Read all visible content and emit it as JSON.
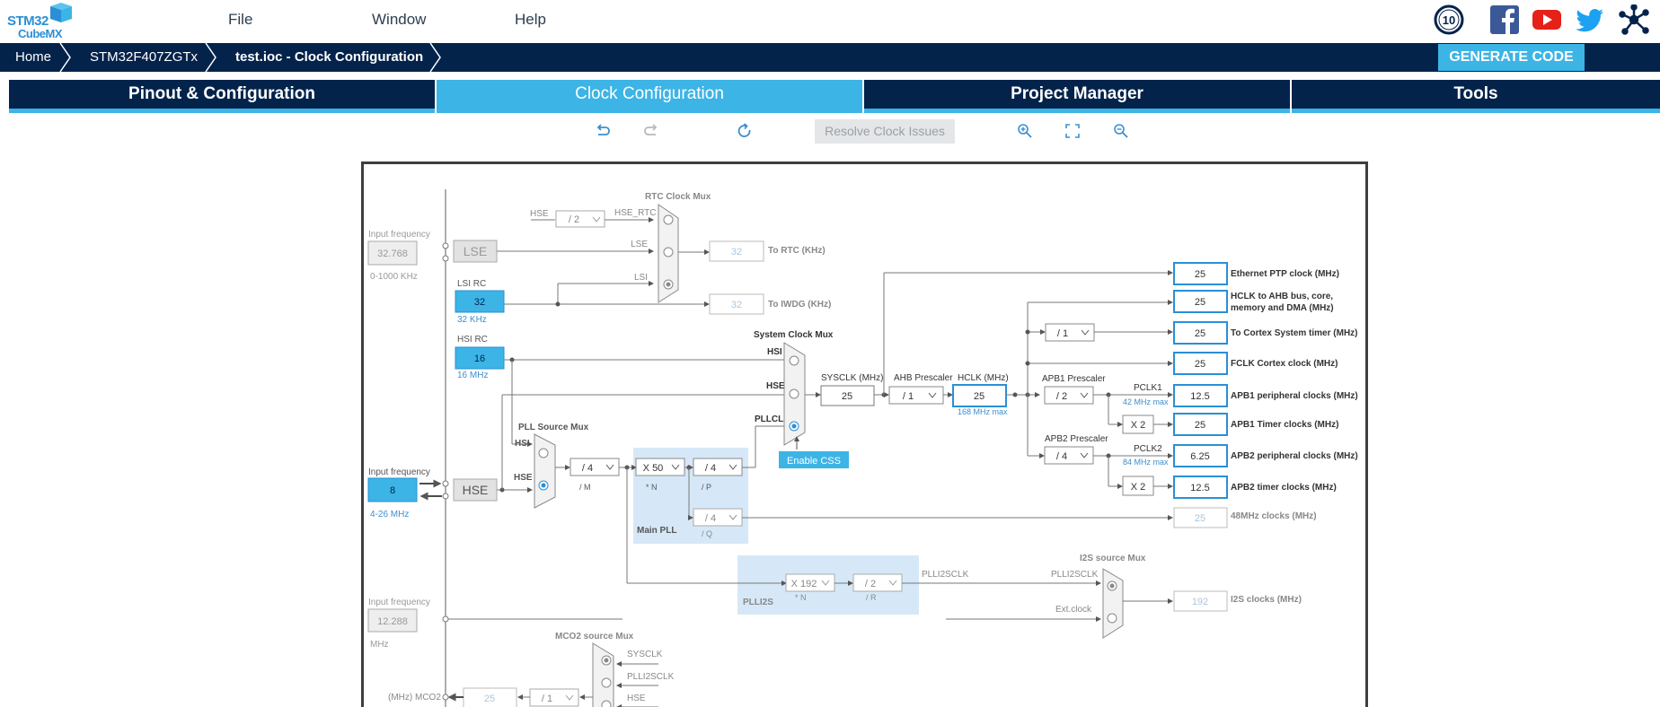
{
  "app": {
    "logo_line1": "STM32",
    "logo_line2": "CubeMX",
    "badge": "10"
  },
  "menu": {
    "file": "File",
    "window": "Window",
    "help": "Help"
  },
  "breadcrumb": {
    "home": "Home",
    "device": "STM32F407ZGTx",
    "file": "test.ioc - Clock Configuration"
  },
  "generate_label": "GENERATE CODE",
  "tabs": {
    "pinout": "Pinout & Configuration",
    "clock": "Clock Configuration",
    "project": "Project Manager",
    "tools": "Tools"
  },
  "toolbar": {
    "resolve": "Resolve Clock Issues"
  },
  "colors": {
    "navy": "#03234b",
    "accent": "#3cb4e6"
  },
  "clock": {
    "rtc_mux_title": "RTC Clock Mux",
    "hse_label": "HSE",
    "rtc_div": "/ 2",
    "hse_rtc": "HSE_RTC",
    "lse_in": "LSE",
    "lsi_in": "LSI",
    "input_freq": "Input frequency",
    "lse_freq": "32.768",
    "lse_range": "0-1000 KHz",
    "lse_block": "LSE",
    "rtc_val": "32",
    "rtc_label": "To RTC (KHz)",
    "lsi_title": "LSI RC",
    "lsi_val": "32",
    "lsi_unit": "32 KHz",
    "iwdg_val": "32",
    "iwdg_label": "To IWDG (KHz)",
    "hsi_title": "HSI RC",
    "hsi_val": "16",
    "hsi_unit": "16 MHz",
    "sysmux_title": "System Clock Mux",
    "hsi_in": "HSI",
    "hse_in": "HSE",
    "pllclk_in": "PLLCLK",
    "pll_src_title": "PLL Source Mux",
    "hse_freq": "8",
    "hse_range": "4-26 MHz",
    "hse_block": "HSE",
    "pllm": "/ 4",
    "pllm_lbl": "/ M",
    "plln": "X 50",
    "plln_lbl": "* N",
    "pllp": "/ 4",
    "pllp_lbl": "/ P",
    "pllq": "/ 4",
    "pllq_lbl": "/ Q",
    "main_pll": "Main PLL",
    "enable_css": "Enable CSS",
    "sysclk_lbl": "SYSCLK (MHz)",
    "sysclk_val": "25",
    "ahb_lbl": "AHB Prescaler",
    "ahb_val": "/ 1",
    "hclk_lbl": "HCLK (MHz)",
    "hclk_val": "25",
    "hclk_max": "168 MHz max",
    "apb1_lbl": "APB1 Prescaler",
    "apb1_val": "/ 2",
    "pclk1": "PCLK1",
    "pclk1_max": "42 MHz max",
    "apb2_lbl": "APB2 Prescaler",
    "apb2_val": "/ 4",
    "pclk2": "PCLK2",
    "pclk2_max": "84 MHz max",
    "cortex_div": "/ 1",
    "x2": "X 2",
    "outputs": [
      {
        "value": "25",
        "label": "Ethernet PTP clock (MHz)"
      },
      {
        "value": "25",
        "label": "HCLK to AHB bus, core,",
        "label2": "memory and DMA (MHz)"
      },
      {
        "value": "25",
        "label": "To Cortex System timer (MHz)"
      },
      {
        "value": "25",
        "label": "FCLK Cortex clock (MHz)"
      },
      {
        "value": "12.5",
        "label": "APB1 peripheral clocks (MHz)"
      },
      {
        "value": "25",
        "label": "APB1 Timer clocks (MHz)"
      },
      {
        "value": "6.25",
        "label": "APB2 peripheral clocks (MHz)"
      },
      {
        "value": "12.5",
        "label": "APB2 timer clocks (MHz)"
      },
      {
        "value": "25",
        "label": "48MHz clocks (MHz)"
      }
    ],
    "i2s_mux_title": "I2S source Mux",
    "plli2s_n": "X 192",
    "plli2s_n_lbl": "* N",
    "plli2s_r": "/ 2",
    "plli2s_r_lbl": "/ R",
    "plli2s": "PLLI2S",
    "plli2sclk": "PLLI2SCLK",
    "ext_clock": "Ext.clock",
    "i2s_val": "192",
    "i2s_label": "I2S clocks (MHz)",
    "ext_freq": "12.288",
    "ext_unit": "MHz",
    "mco2_title": "MCO2 source Mux",
    "mco2_sysclk": "SYSCLK",
    "mco2_plli2s": "PLLI2SCLK",
    "mco2_hse": "HSE",
    "mco2_lbl": "(MHz) MCO2",
    "mco2_val": "25",
    "mco2_div": "/ 1"
  }
}
